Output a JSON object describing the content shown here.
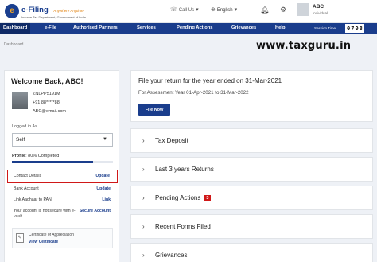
{
  "header": {
    "logo_title": "e-Filing",
    "logo_tagline": "Anywhere Anytime",
    "logo_subtitle": "Income Tax Department, Government of India",
    "call_us": "Call Us",
    "language": "English",
    "user_name": "ABC",
    "user_type": "Individual"
  },
  "nav": {
    "items": [
      {
        "label": "Dashboard"
      },
      {
        "label": "e-File"
      },
      {
        "label": "Authorised Partners"
      },
      {
        "label": "Services"
      },
      {
        "label": "Pending Actions"
      },
      {
        "label": "Grievances"
      },
      {
        "label": "Help"
      }
    ],
    "session_label": "Session Time",
    "session_digits": [
      "0",
      "7",
      "0",
      "8"
    ],
    "accent": "#1a3d8c"
  },
  "breadcrumb": "Dashboard",
  "watermark": "www.taxguru.in",
  "profile": {
    "welcome": "Welcome Back, ABC!",
    "pan": "ZNLPP5191M",
    "mobile": "+91 88*****88",
    "email": "ABC@email.com",
    "logged_in_label": "Logged in As",
    "role": "Self",
    "profile_label": "Profile",
    "profile_completion_text": ": 80% Completed",
    "profile_completion_pct": 80,
    "rows": {
      "contact": {
        "label": "Contact Details",
        "action": "Update"
      },
      "bank": {
        "label": "Bank Account",
        "action": "Update"
      },
      "aadhaar": {
        "label": "Link Aadhaar to PAN",
        "action": "Link"
      },
      "secure": {
        "label": "Your account is not secure with e-vault",
        "action": "Secure Account"
      }
    },
    "certificate_title": "Certificate of Appreciation",
    "certificate_link": "View Certificate",
    "highlight_color": "#d01818"
  },
  "file_return": {
    "title": "File your return for the year ended on 31-Mar-2021",
    "subtitle": "For Assessment Year 01-Apr-2021 to 31-Mar-2022",
    "button": "File Now"
  },
  "accordions": {
    "tax_deposit": "Tax Deposit",
    "last_returns": "Last 3 years Returns",
    "pending_actions": "Pending Actions",
    "pending_count": "3",
    "recent_forms": "Recent Forms Filed",
    "grievances": "Grievances"
  }
}
